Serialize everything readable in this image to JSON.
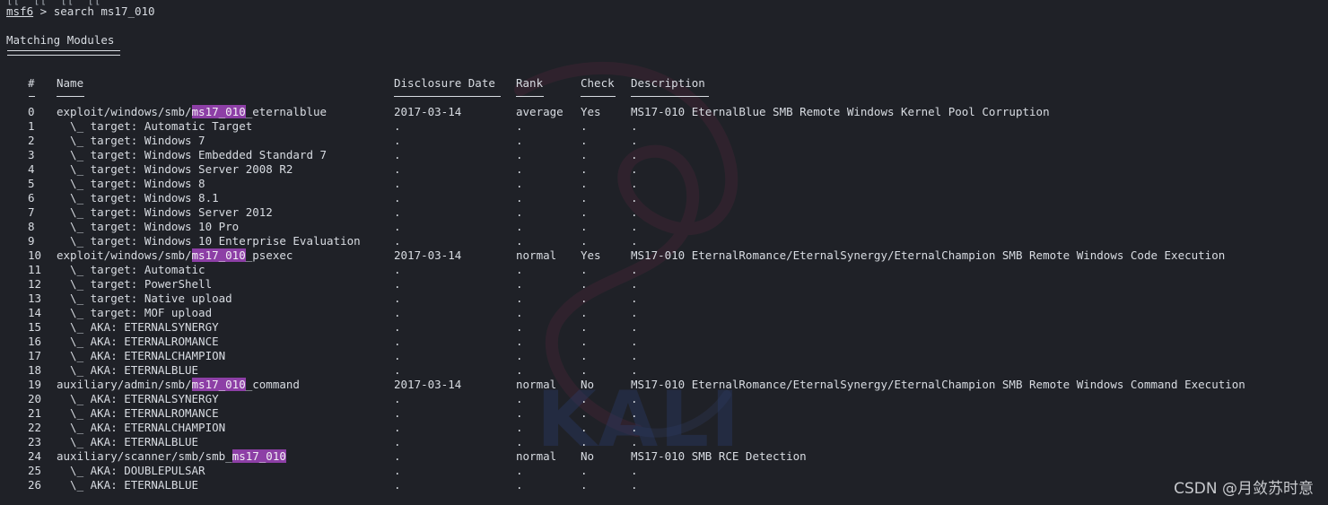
{
  "terminal": {
    "top_fragment": "[[\" [[\" [[\" [[\"",
    "prompt": "msf6",
    "prompt_suffix": " > ",
    "command": "search ms17_010",
    "heading": "Matching Modules",
    "highlight_color": "#8d3fa6",
    "background_color": "#1f2127"
  },
  "table": {
    "headers": {
      "num": "#",
      "name": "Name",
      "date": "Disclosure Date",
      "rank": "Rank",
      "check": "Check",
      "desc": "Description"
    },
    "rows": [
      {
        "num": "0",
        "name": [
          "exploit/windows/smb/",
          "ms17_010",
          "_eternalblue"
        ],
        "date": "2017-03-14",
        "rank": "average",
        "check": "Yes",
        "desc": "MS17-010 EternalBlue SMB Remote Windows Kernel Pool Corruption"
      },
      {
        "num": "1",
        "name": [
          "  \\_ target: Automatic Target",
          "",
          ""
        ],
        "date": ".",
        "rank": ".",
        "check": ".",
        "desc": "."
      },
      {
        "num": "2",
        "name": [
          "  \\_ target: Windows 7",
          "",
          ""
        ],
        "date": ".",
        "rank": ".",
        "check": ".",
        "desc": "."
      },
      {
        "num": "3",
        "name": [
          "  \\_ target: Windows Embedded Standard 7",
          "",
          ""
        ],
        "date": ".",
        "rank": ".",
        "check": ".",
        "desc": "."
      },
      {
        "num": "4",
        "name": [
          "  \\_ target: Windows Server 2008 R2",
          "",
          ""
        ],
        "date": ".",
        "rank": ".",
        "check": ".",
        "desc": "."
      },
      {
        "num": "5",
        "name": [
          "  \\_ target: Windows 8",
          "",
          ""
        ],
        "date": ".",
        "rank": ".",
        "check": ".",
        "desc": "."
      },
      {
        "num": "6",
        "name": [
          "  \\_ target: Windows 8.1",
          "",
          ""
        ],
        "date": ".",
        "rank": ".",
        "check": ".",
        "desc": "."
      },
      {
        "num": "7",
        "name": [
          "  \\_ target: Windows Server 2012",
          "",
          ""
        ],
        "date": ".",
        "rank": ".",
        "check": ".",
        "desc": "."
      },
      {
        "num": "8",
        "name": [
          "  \\_ target: Windows 10 Pro",
          "",
          ""
        ],
        "date": ".",
        "rank": ".",
        "check": ".",
        "desc": "."
      },
      {
        "num": "9",
        "name": [
          "  \\_ target: Windows 10 Enterprise Evaluation",
          "",
          ""
        ],
        "date": ".",
        "rank": ".",
        "check": ".",
        "desc": "."
      },
      {
        "num": "10",
        "name": [
          "exploit/windows/smb/",
          "ms17_010",
          "_psexec"
        ],
        "date": "2017-03-14",
        "rank": "normal",
        "check": "Yes",
        "desc": "MS17-010 EternalRomance/EternalSynergy/EternalChampion SMB Remote Windows Code Execution"
      },
      {
        "num": "11",
        "name": [
          "  \\_ target: Automatic",
          "",
          ""
        ],
        "date": ".",
        "rank": ".",
        "check": ".",
        "desc": "."
      },
      {
        "num": "12",
        "name": [
          "  \\_ target: PowerShell",
          "",
          ""
        ],
        "date": ".",
        "rank": ".",
        "check": ".",
        "desc": "."
      },
      {
        "num": "13",
        "name": [
          "  \\_ target: Native upload",
          "",
          ""
        ],
        "date": ".",
        "rank": ".",
        "check": ".",
        "desc": "."
      },
      {
        "num": "14",
        "name": [
          "  \\_ target: MOF upload",
          "",
          ""
        ],
        "date": ".",
        "rank": ".",
        "check": ".",
        "desc": "."
      },
      {
        "num": "15",
        "name": [
          "  \\_ AKA: ETERNALSYNERGY",
          "",
          ""
        ],
        "date": ".",
        "rank": ".",
        "check": ".",
        "desc": "."
      },
      {
        "num": "16",
        "name": [
          "  \\_ AKA: ETERNALROMANCE",
          "",
          ""
        ],
        "date": ".",
        "rank": ".",
        "check": ".",
        "desc": "."
      },
      {
        "num": "17",
        "name": [
          "  \\_ AKA: ETERNALCHAMPION",
          "",
          ""
        ],
        "date": ".",
        "rank": ".",
        "check": ".",
        "desc": "."
      },
      {
        "num": "18",
        "name": [
          "  \\_ AKA: ETERNALBLUE",
          "",
          ""
        ],
        "date": ".",
        "rank": ".",
        "check": ".",
        "desc": "."
      },
      {
        "num": "19",
        "name": [
          "auxiliary/admin/smb/",
          "ms17_010",
          "_command"
        ],
        "date": "2017-03-14",
        "rank": "normal",
        "check": "No",
        "desc": "MS17-010 EternalRomance/EternalSynergy/EternalChampion SMB Remote Windows Command Execution"
      },
      {
        "num": "20",
        "name": [
          "  \\_ AKA: ETERNALSYNERGY",
          "",
          ""
        ],
        "date": ".",
        "rank": ".",
        "check": ".",
        "desc": "."
      },
      {
        "num": "21",
        "name": [
          "  \\_ AKA: ETERNALROMANCE",
          "",
          ""
        ],
        "date": ".",
        "rank": ".",
        "check": ".",
        "desc": "."
      },
      {
        "num": "22",
        "name": [
          "  \\_ AKA: ETERNALCHAMPION",
          "",
          ""
        ],
        "date": ".",
        "rank": ".",
        "check": ".",
        "desc": "."
      },
      {
        "num": "23",
        "name": [
          "  \\_ AKA: ETERNALBLUE",
          "",
          ""
        ],
        "date": ".",
        "rank": ".",
        "check": ".",
        "desc": "."
      },
      {
        "num": "24",
        "name": [
          "auxiliary/scanner/smb/smb_",
          "ms17_010",
          ""
        ],
        "date": ".",
        "rank": "normal",
        "check": "No",
        "desc": "MS17-010 SMB RCE Detection"
      },
      {
        "num": "25",
        "name": [
          "  \\_ AKA: DOUBLEPULSAR",
          "",
          ""
        ],
        "date": ".",
        "rank": ".",
        "check": ".",
        "desc": "."
      },
      {
        "num": "26",
        "name": [
          "  \\_ AKA: ETERNALBLUE",
          "",
          ""
        ],
        "date": ".",
        "rank": ".",
        "check": ".",
        "desc": "."
      }
    ]
  },
  "watermark": {
    "text": "KALI",
    "icon": "kali-dragon-icon"
  },
  "footer": {
    "credit": "CSDN @月敛苏时意"
  }
}
